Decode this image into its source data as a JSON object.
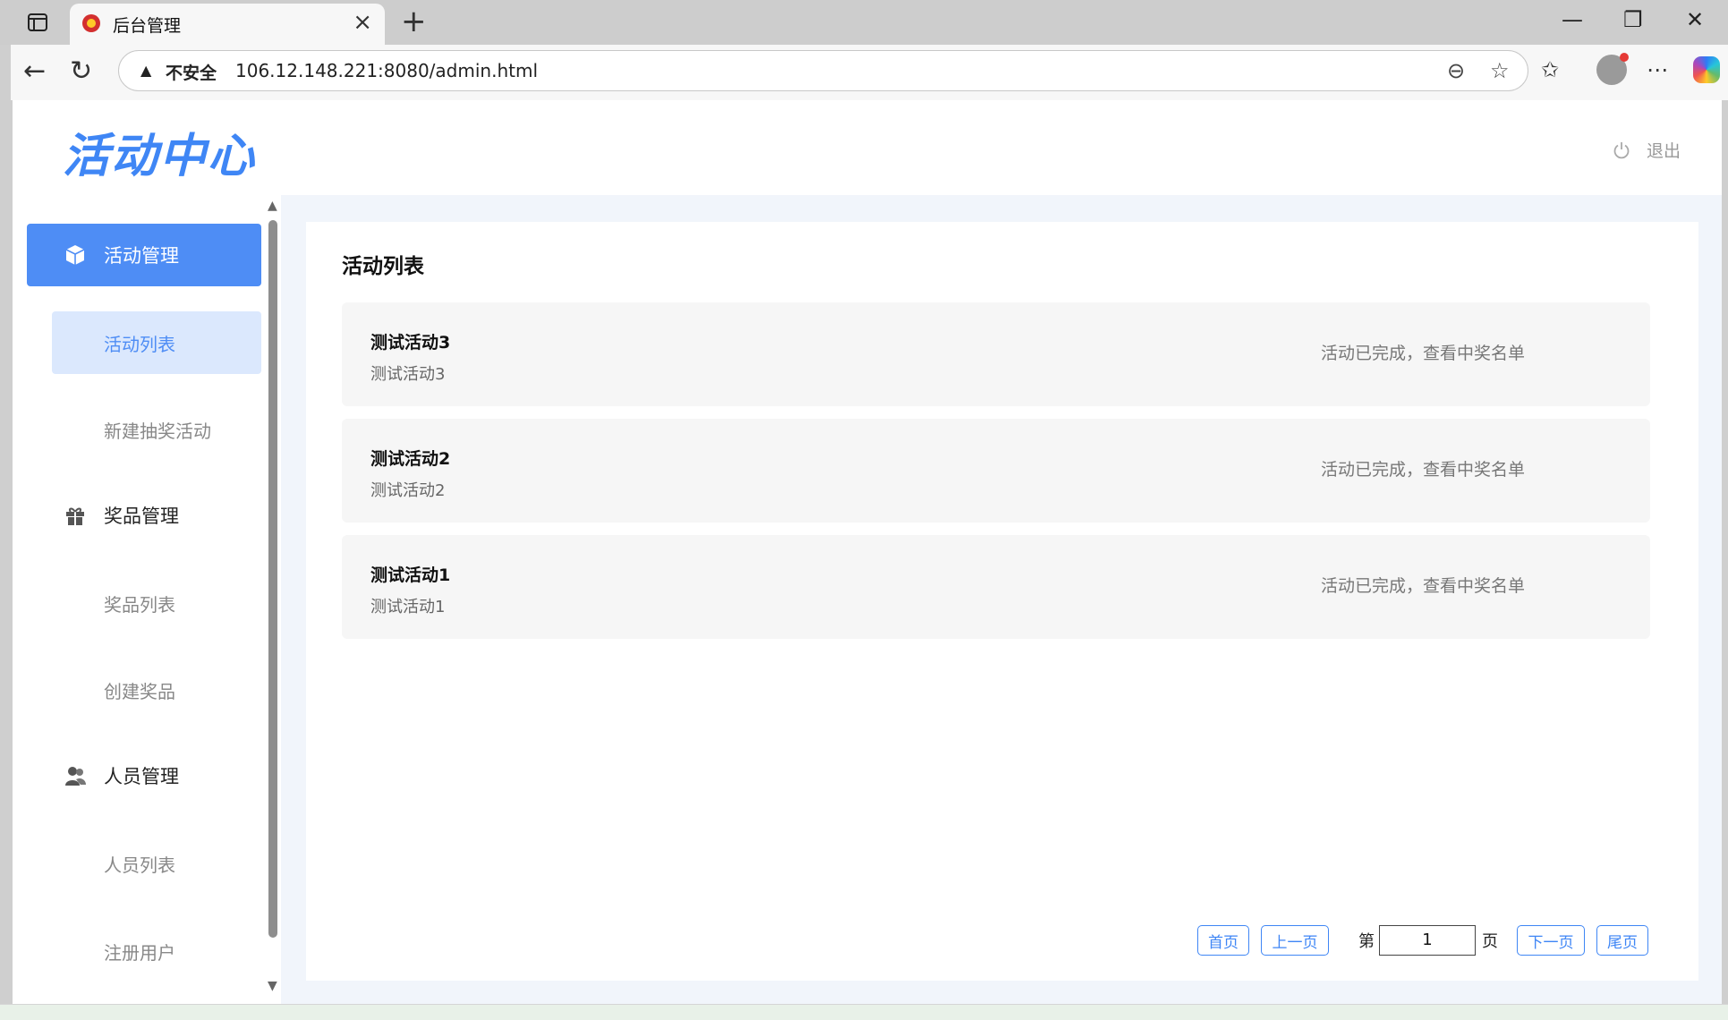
{
  "browser": {
    "tab_title": "后台管理",
    "security_label": "不安全",
    "url": "106.12.148.221:8080/admin.html"
  },
  "header": {
    "logo_text": "活动中心",
    "logout_label": "退出"
  },
  "sidebar": {
    "groups": [
      {
        "label": "活动管理",
        "icon": "cube-icon",
        "active": true,
        "items": [
          {
            "label": "活动列表",
            "active": true
          },
          {
            "label": "新建抽奖活动"
          }
        ]
      },
      {
        "label": "奖品管理",
        "icon": "gift-icon",
        "items": [
          {
            "label": "奖品列表"
          },
          {
            "label": "创建奖品"
          }
        ]
      },
      {
        "label": "人员管理",
        "icon": "users-icon",
        "items": [
          {
            "label": "人员列表"
          },
          {
            "label": "注册用户"
          }
        ]
      }
    ]
  },
  "main": {
    "title": "活动列表",
    "activities": [
      {
        "name": "测试活动3",
        "desc": "测试活动3",
        "status": "活动已完成，查看中奖名单"
      },
      {
        "name": "测试活动2",
        "desc": "测试活动2",
        "status": "活动已完成，查看中奖名单"
      },
      {
        "name": "测试活动1",
        "desc": "测试活动1",
        "status": "活动已完成，查看中奖名单"
      }
    ],
    "pagination": {
      "first": "首页",
      "prev": "上一页",
      "page_prefix": "第",
      "current_page": "1",
      "page_suffix": "页",
      "next": "下一页",
      "last": "尾页"
    }
  },
  "colors": {
    "accent": "#4e8df5",
    "accent_light": "#dbe8fd",
    "content_bg": "#f1f5fb"
  }
}
